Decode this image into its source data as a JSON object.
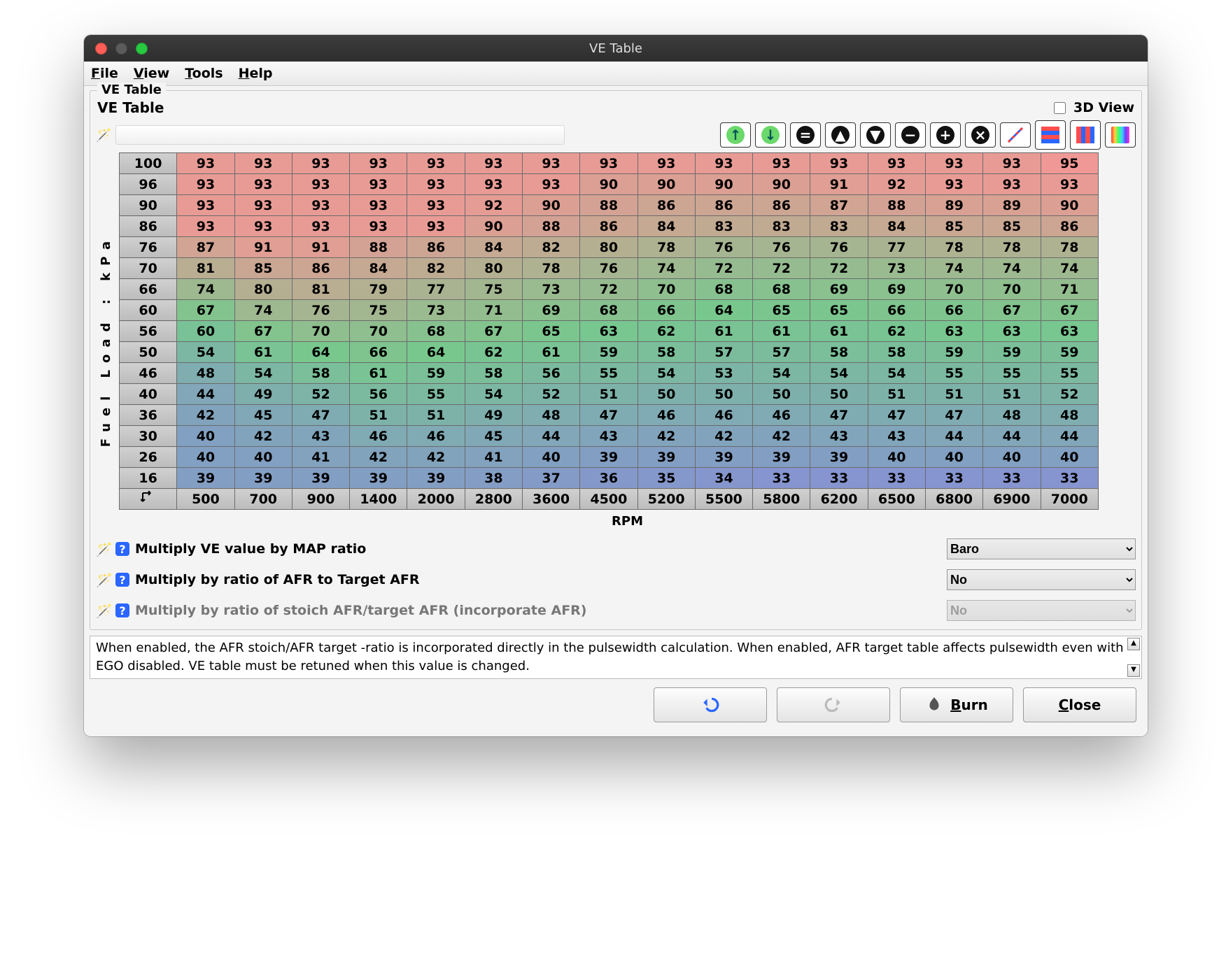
{
  "window": {
    "title": "VE Table"
  },
  "menu": {
    "file_u": "F",
    "file_rest": "ile",
    "view_u": "V",
    "view_rest": "iew",
    "tools_u": "T",
    "tools_rest": "ools",
    "help_u": "H",
    "help_rest": "elp"
  },
  "group": {
    "legend": "VE Table",
    "title": "VE Table",
    "view3d_u": "D",
    "view3d_rest": "View"
  },
  "table": {
    "ylabel": "Fuel Load : kPa",
    "xlabel": "RPM",
    "xaxis": [
      500,
      700,
      900,
      1400,
      2000,
      2800,
      3600,
      4500,
      5200,
      5500,
      5800,
      6200,
      6500,
      6800,
      6900,
      7000
    ],
    "yaxis": [
      100,
      96,
      90,
      86,
      76,
      70,
      66,
      60,
      56,
      50,
      46,
      40,
      36,
      30,
      26,
      16
    ],
    "cells": [
      [
        93,
        93,
        93,
        93,
        93,
        93,
        93,
        93,
        93,
        93,
        93,
        93,
        93,
        93,
        93,
        95
      ],
      [
        93,
        93,
        93,
        93,
        93,
        93,
        93,
        90,
        90,
        90,
        90,
        91,
        92,
        93,
        93,
        93
      ],
      [
        93,
        93,
        93,
        93,
        93,
        92,
        90,
        88,
        86,
        86,
        86,
        87,
        88,
        89,
        89,
        90
      ],
      [
        93,
        93,
        93,
        93,
        93,
        90,
        88,
        86,
        84,
        83,
        83,
        83,
        84,
        85,
        85,
        86
      ],
      [
        87,
        91,
        91,
        88,
        86,
        84,
        82,
        80,
        78,
        76,
        76,
        76,
        77,
        78,
        78,
        78
      ],
      [
        81,
        85,
        86,
        84,
        82,
        80,
        78,
        76,
        74,
        72,
        72,
        72,
        73,
        74,
        74,
        74
      ],
      [
        74,
        80,
        81,
        79,
        77,
        75,
        73,
        72,
        70,
        68,
        68,
        69,
        69,
        70,
        70,
        71
      ],
      [
        67,
        74,
        76,
        75,
        73,
        71,
        69,
        68,
        66,
        64,
        65,
        65,
        66,
        66,
        67,
        67
      ],
      [
        60,
        67,
        70,
        70,
        68,
        67,
        65,
        63,
        62,
        61,
        61,
        61,
        62,
        63,
        63,
        63
      ],
      [
        54,
        61,
        64,
        66,
        64,
        62,
        61,
        59,
        58,
        57,
        57,
        58,
        58,
        59,
        59,
        59
      ],
      [
        48,
        54,
        58,
        61,
        59,
        58,
        56,
        55,
        54,
        53,
        54,
        54,
        54,
        55,
        55,
        55
      ],
      [
        44,
        49,
        52,
        56,
        55,
        54,
        52,
        51,
        50,
        50,
        50,
        50,
        51,
        51,
        51,
        52
      ],
      [
        42,
        45,
        47,
        51,
        51,
        49,
        48,
        47,
        46,
        46,
        46,
        47,
        47,
        47,
        48,
        48
      ],
      [
        40,
        42,
        43,
        46,
        46,
        45,
        44,
        43,
        42,
        42,
        42,
        43,
        43,
        44,
        44,
        44
      ],
      [
        40,
        40,
        41,
        42,
        42,
        41,
        40,
        39,
        39,
        39,
        39,
        39,
        40,
        40,
        40,
        40
      ],
      [
        39,
        39,
        39,
        39,
        39,
        38,
        37,
        36,
        35,
        34,
        33,
        33,
        33,
        33,
        33,
        33
      ]
    ]
  },
  "chart_data": {
    "type": "heatmap",
    "title": "VE Table",
    "xlabel": "RPM",
    "ylabel": "Fuel Load : kPa",
    "x": [
      500,
      700,
      900,
      1400,
      2000,
      2800,
      3600,
      4500,
      5200,
      5500,
      5800,
      6200,
      6500,
      6800,
      6900,
      7000
    ],
    "y": [
      100,
      96,
      90,
      86,
      76,
      70,
      66,
      60,
      56,
      50,
      46,
      40,
      36,
      30,
      26,
      16
    ],
    "z": [
      [
        93,
        93,
        93,
        93,
        93,
        93,
        93,
        93,
        93,
        93,
        93,
        93,
        93,
        93,
        93,
        95
      ],
      [
        93,
        93,
        93,
        93,
        93,
        93,
        93,
        90,
        90,
        90,
        90,
        91,
        92,
        93,
        93,
        93
      ],
      [
        93,
        93,
        93,
        93,
        93,
        92,
        90,
        88,
        86,
        86,
        86,
        87,
        88,
        89,
        89,
        90
      ],
      [
        93,
        93,
        93,
        93,
        93,
        90,
        88,
        86,
        84,
        83,
        83,
        83,
        84,
        85,
        85,
        86
      ],
      [
        87,
        91,
        91,
        88,
        86,
        84,
        82,
        80,
        78,
        76,
        76,
        76,
        77,
        78,
        78,
        78
      ],
      [
        81,
        85,
        86,
        84,
        82,
        80,
        78,
        76,
        74,
        72,
        72,
        72,
        73,
        74,
        74,
        74
      ],
      [
        74,
        80,
        81,
        79,
        77,
        75,
        73,
        72,
        70,
        68,
        68,
        69,
        69,
        70,
        70,
        71
      ],
      [
        67,
        74,
        76,
        75,
        73,
        71,
        69,
        68,
        66,
        64,
        65,
        65,
        66,
        66,
        67,
        67
      ],
      [
        60,
        67,
        70,
        70,
        68,
        67,
        65,
        63,
        62,
        61,
        61,
        61,
        62,
        63,
        63,
        63
      ],
      [
        54,
        61,
        64,
        66,
        64,
        62,
        61,
        59,
        58,
        57,
        57,
        58,
        58,
        59,
        59,
        59
      ],
      [
        48,
        54,
        58,
        61,
        59,
        58,
        56,
        55,
        54,
        53,
        54,
        54,
        54,
        55,
        55,
        55
      ],
      [
        44,
        49,
        52,
        56,
        55,
        54,
        52,
        51,
        50,
        50,
        50,
        50,
        51,
        51,
        51,
        52
      ],
      [
        42,
        45,
        47,
        51,
        51,
        49,
        48,
        47,
        46,
        46,
        46,
        47,
        47,
        47,
        48,
        48
      ],
      [
        40,
        42,
        43,
        46,
        46,
        45,
        44,
        43,
        42,
        42,
        42,
        43,
        43,
        44,
        44,
        44
      ],
      [
        40,
        40,
        41,
        42,
        42,
        41,
        40,
        39,
        39,
        39,
        39,
        39,
        40,
        40,
        40,
        40
      ],
      [
        39,
        39,
        39,
        39,
        39,
        38,
        37,
        36,
        35,
        34,
        33,
        33,
        33,
        33,
        33,
        33
      ]
    ],
    "zlim": [
      33,
      95
    ]
  },
  "options": [
    {
      "label": "Multiply VE value by MAP ratio",
      "value": "Baro",
      "disabled": false,
      "name": "opt-map-ratio"
    },
    {
      "label": "Multiply by ratio of AFR to Target AFR",
      "value": "No",
      "disabled": false,
      "name": "opt-afr-ratio"
    },
    {
      "label": "Multiply by ratio of stoich AFR/target AFR (incorporate AFR)",
      "value": "No",
      "disabled": true,
      "name": "opt-stoich-ratio"
    }
  ],
  "info": {
    "text": "When enabled, the AFR stoich/AFR target -ratio is incorporated directly in the pulsewidth calculation. When enabled, AFR target table affects pulsewidth even with EGO disabled. VE table must be retuned when this value is changed."
  },
  "buttons": {
    "burn_u": "B",
    "burn_rest": "urn",
    "close_u": "C",
    "close_rest": "lose"
  }
}
